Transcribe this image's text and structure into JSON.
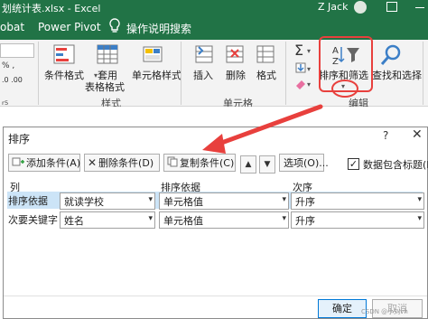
{
  "titlebar": {
    "filename": "划统计表.xlsx  -  Excel",
    "user": "Z Jack"
  },
  "menubar": {
    "tab_robat": "obat",
    "tab_powerpivot": "Power Pivot",
    "tell_me": "操作说明搜索"
  },
  "ribbon": {
    "cond_format": "条件格式",
    "table_format_1": "套用",
    "table_format_2": "表格格式",
    "cell_style": "单元格样式",
    "styles_group": "样式",
    "insert": "插入",
    "delete": "删除",
    "format": "格式",
    "cells_group": "单元格",
    "sort_filter": "排序和筛选",
    "find_select": "查找和选择",
    "edit_group": "编辑",
    "launcher_text": "ᵣ₅"
  },
  "dialog": {
    "title": "排序",
    "help": "?",
    "close": "✕",
    "add_level": "添加条件(A)",
    "delete_level": "删除条件(D)",
    "copy_level": "复制条件(C)",
    "options": "选项(O)...",
    "has_headers": "数据包含标题(H)",
    "col_header": "列",
    "sorton_header": "排序依据",
    "order_header": "次序",
    "rows": [
      {
        "label": "排序依据",
        "column": "就读学校",
        "sort_on": "单元格值",
        "order": "升序"
      },
      {
        "label": "次要关键字",
        "column": "姓名",
        "sort_on": "单元格值",
        "order": "升序"
      }
    ],
    "ok": "确定",
    "cancel": "取消"
  },
  "watermark": "CSDN @小刘vh",
  "colors": {
    "excel_green": "#217346",
    "annotation_red": "#e8403d",
    "selected_row": "#cce4f7"
  }
}
